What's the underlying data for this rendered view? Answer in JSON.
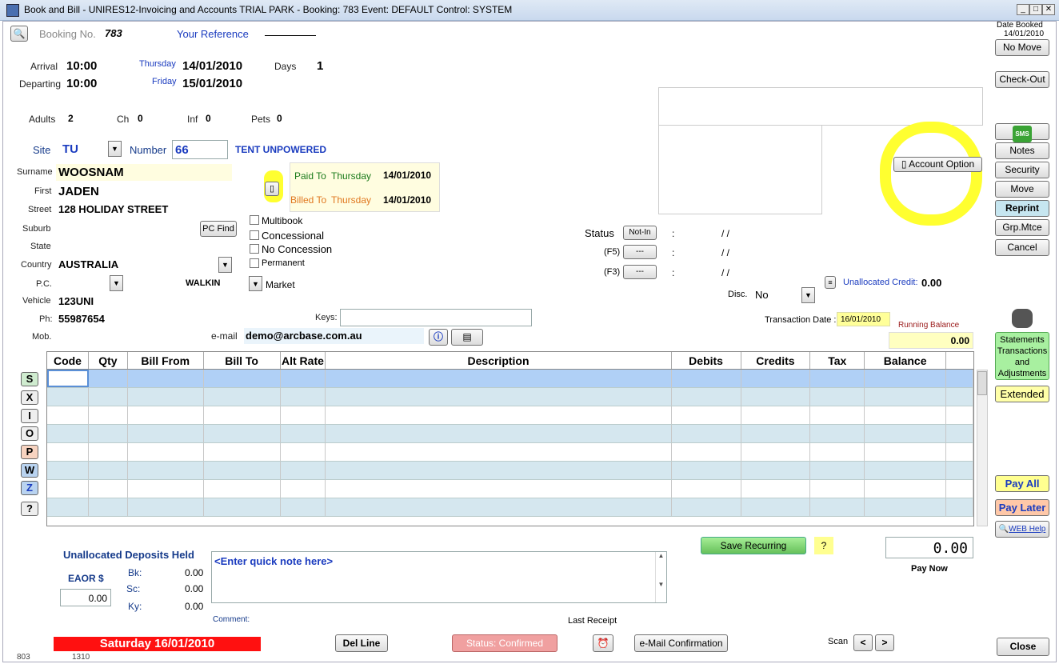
{
  "window": {
    "title": "Book and Bill - UNIRES12-Invoicing and Accounts TRIAL PARK - Booking: 783 Event: DEFAULT Control: SYSTEM"
  },
  "header": {
    "booking_no_label": "Booking No.",
    "booking_no": "783",
    "your_reference_label": "Your Reference",
    "date_booked_label": "Date Booked",
    "date_booked": "14/01/2010"
  },
  "stay": {
    "arrival_label": "Arrival",
    "arrival_time": "10:00",
    "arrival_day": "Thursday",
    "arrival_date": "14/01/2010",
    "days_label": "Days",
    "days": "1",
    "departing_label": "Departing",
    "departing_time": "10:00",
    "departing_day": "Friday",
    "departing_date": "15/01/2010"
  },
  "guests": {
    "adults_label": "Adults",
    "adults": "2",
    "ch_label": "Ch",
    "ch": "0",
    "inf_label": "Inf",
    "inf": "0",
    "pets_label": "Pets",
    "pets": "0"
  },
  "site": {
    "site_label": "Site",
    "site": "TU",
    "number_label": "Number",
    "number": "66",
    "type": "TENT UNPOWERED"
  },
  "customer": {
    "surname_label": "Surname",
    "surname": "WOOSNAM",
    "first_label": "First",
    "first": "JADEN",
    "street_label": "Street",
    "street": "128 HOLIDAY STREET",
    "suburb_label": "Suburb",
    "state_label": "State",
    "country_label": "Country",
    "country": "AUSTRALIA",
    "pc_label": "P.C.",
    "source": "WALKIN",
    "vehicle_label": "Vehicle",
    "vehicle": "123UNI",
    "ph_label": "Ph:",
    "ph": "55987654",
    "mob_label": "Mob.",
    "email_label": "e-mail",
    "email": "demo@arcbase.com.au",
    "keys_label": "Keys:",
    "pc_find": "PC Find"
  },
  "paid": {
    "paid_to_label": "Paid To",
    "paid_to_day": "Thursday",
    "paid_to_date": "14/01/2010",
    "billed_to_label": "Billed To",
    "billed_to_day": "Thursday",
    "billed_to_date": "14/01/2010"
  },
  "options": {
    "multibook": "Multibook",
    "concessional": "Concessional",
    "no_concession": "No Concession",
    "permanent": "Permanent",
    "market": "Market"
  },
  "status": {
    "status_label": "Status",
    "status_btn": "Not-In",
    "f5_label": "(F5)",
    "f3_label": "(F3)",
    "dash_btn": "---",
    "colon": ":",
    "slashes": "/ /",
    "disc_label": "Disc.",
    "disc": "No",
    "unalloc_credit_label": "Unallocated Credit:",
    "unalloc_credit": "0.00",
    "transaction_date_label": "Transaction Date :",
    "transaction_date": "16/01/2010",
    "running_balance_label": "Running Balance",
    "running_balance": "0.00"
  },
  "account_option": "Account Option",
  "right_buttons": {
    "no_move": "No Move",
    "check_out": "Check-Out",
    "sms": "SMS",
    "notes": "Notes",
    "security": "Security",
    "move": "Move",
    "reprint": "Reprint",
    "grp_mtce": "Grp.Mtce",
    "cancel": "Cancel",
    "statements": "Statements Transactions and Adjustments",
    "extended": "Extended",
    "pay_all": "Pay All",
    "pay_later": "Pay Later",
    "web_help": "WEB Help",
    "close": "Close"
  },
  "table": {
    "columns": [
      "Code",
      "Qty",
      "Bill From",
      "Bill To",
      "Alt Rate",
      "Description",
      "Debits",
      "Credits",
      "Tax",
      "Balance"
    ],
    "row_count": 8
  },
  "side_buttons": [
    "S",
    "X",
    "I",
    "O",
    "P",
    "W",
    "Z",
    "?"
  ],
  "deposits": {
    "title": "Unallocated Deposits Held",
    "eaor_label": "EAOR $",
    "eaor": "0.00",
    "bk_label": "Bk:",
    "bk": "0.00",
    "sc_label": "Sc:",
    "sc": "0.00",
    "ky_label": "Ky:",
    "ky": "0.00"
  },
  "note": {
    "placeholder": "<Enter quick note here>",
    "comment_label": "Comment:"
  },
  "bottom": {
    "save_recurring": "Save Recurring",
    "help_q": "?",
    "pay_now_amount": "0.00",
    "pay_now_label": "Pay Now",
    "last_receipt_label": "Last Receipt",
    "date_banner": "Saturday 16/01/2010",
    "del_line": "Del Line",
    "status_confirmed": "Status: Confirmed",
    "email_confirmation": "e-Mail Confirmation",
    "scan_label": "Scan",
    "prev": "<",
    "next": ">",
    "footer_left": "803",
    "footer_right": "1310"
  }
}
